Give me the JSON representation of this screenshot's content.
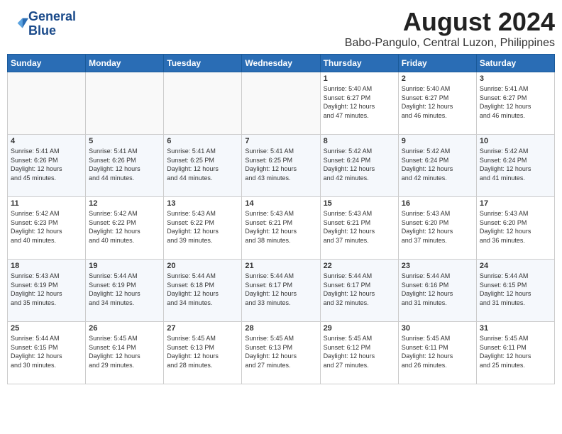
{
  "header": {
    "logo_line1": "General",
    "logo_line2": "Blue",
    "month_year": "August 2024",
    "location": "Babo-Pangulo, Central Luzon, Philippines"
  },
  "weekdays": [
    "Sunday",
    "Monday",
    "Tuesday",
    "Wednesday",
    "Thursday",
    "Friday",
    "Saturday"
  ],
  "weeks": [
    [
      {
        "day": "",
        "info": ""
      },
      {
        "day": "",
        "info": ""
      },
      {
        "day": "",
        "info": ""
      },
      {
        "day": "",
        "info": ""
      },
      {
        "day": "1",
        "info": "Sunrise: 5:40 AM\nSunset: 6:27 PM\nDaylight: 12 hours\nand 47 minutes."
      },
      {
        "day": "2",
        "info": "Sunrise: 5:40 AM\nSunset: 6:27 PM\nDaylight: 12 hours\nand 46 minutes."
      },
      {
        "day": "3",
        "info": "Sunrise: 5:41 AM\nSunset: 6:27 PM\nDaylight: 12 hours\nand 46 minutes."
      }
    ],
    [
      {
        "day": "4",
        "info": "Sunrise: 5:41 AM\nSunset: 6:26 PM\nDaylight: 12 hours\nand 45 minutes."
      },
      {
        "day": "5",
        "info": "Sunrise: 5:41 AM\nSunset: 6:26 PM\nDaylight: 12 hours\nand 44 minutes."
      },
      {
        "day": "6",
        "info": "Sunrise: 5:41 AM\nSunset: 6:25 PM\nDaylight: 12 hours\nand 44 minutes."
      },
      {
        "day": "7",
        "info": "Sunrise: 5:41 AM\nSunset: 6:25 PM\nDaylight: 12 hours\nand 43 minutes."
      },
      {
        "day": "8",
        "info": "Sunrise: 5:42 AM\nSunset: 6:24 PM\nDaylight: 12 hours\nand 42 minutes."
      },
      {
        "day": "9",
        "info": "Sunrise: 5:42 AM\nSunset: 6:24 PM\nDaylight: 12 hours\nand 42 minutes."
      },
      {
        "day": "10",
        "info": "Sunrise: 5:42 AM\nSunset: 6:24 PM\nDaylight: 12 hours\nand 41 minutes."
      }
    ],
    [
      {
        "day": "11",
        "info": "Sunrise: 5:42 AM\nSunset: 6:23 PM\nDaylight: 12 hours\nand 40 minutes."
      },
      {
        "day": "12",
        "info": "Sunrise: 5:42 AM\nSunset: 6:22 PM\nDaylight: 12 hours\nand 40 minutes."
      },
      {
        "day": "13",
        "info": "Sunrise: 5:43 AM\nSunset: 6:22 PM\nDaylight: 12 hours\nand 39 minutes."
      },
      {
        "day": "14",
        "info": "Sunrise: 5:43 AM\nSunset: 6:21 PM\nDaylight: 12 hours\nand 38 minutes."
      },
      {
        "day": "15",
        "info": "Sunrise: 5:43 AM\nSunset: 6:21 PM\nDaylight: 12 hours\nand 37 minutes."
      },
      {
        "day": "16",
        "info": "Sunrise: 5:43 AM\nSunset: 6:20 PM\nDaylight: 12 hours\nand 37 minutes."
      },
      {
        "day": "17",
        "info": "Sunrise: 5:43 AM\nSunset: 6:20 PM\nDaylight: 12 hours\nand 36 minutes."
      }
    ],
    [
      {
        "day": "18",
        "info": "Sunrise: 5:43 AM\nSunset: 6:19 PM\nDaylight: 12 hours\nand 35 minutes."
      },
      {
        "day": "19",
        "info": "Sunrise: 5:44 AM\nSunset: 6:19 PM\nDaylight: 12 hours\nand 34 minutes."
      },
      {
        "day": "20",
        "info": "Sunrise: 5:44 AM\nSunset: 6:18 PM\nDaylight: 12 hours\nand 34 minutes."
      },
      {
        "day": "21",
        "info": "Sunrise: 5:44 AM\nSunset: 6:17 PM\nDaylight: 12 hours\nand 33 minutes."
      },
      {
        "day": "22",
        "info": "Sunrise: 5:44 AM\nSunset: 6:17 PM\nDaylight: 12 hours\nand 32 minutes."
      },
      {
        "day": "23",
        "info": "Sunrise: 5:44 AM\nSunset: 6:16 PM\nDaylight: 12 hours\nand 31 minutes."
      },
      {
        "day": "24",
        "info": "Sunrise: 5:44 AM\nSunset: 6:15 PM\nDaylight: 12 hours\nand 31 minutes."
      }
    ],
    [
      {
        "day": "25",
        "info": "Sunrise: 5:44 AM\nSunset: 6:15 PM\nDaylight: 12 hours\nand 30 minutes."
      },
      {
        "day": "26",
        "info": "Sunrise: 5:45 AM\nSunset: 6:14 PM\nDaylight: 12 hours\nand 29 minutes."
      },
      {
        "day": "27",
        "info": "Sunrise: 5:45 AM\nSunset: 6:13 PM\nDaylight: 12 hours\nand 28 minutes."
      },
      {
        "day": "28",
        "info": "Sunrise: 5:45 AM\nSunset: 6:13 PM\nDaylight: 12 hours\nand 27 minutes."
      },
      {
        "day": "29",
        "info": "Sunrise: 5:45 AM\nSunset: 6:12 PM\nDaylight: 12 hours\nand 27 minutes."
      },
      {
        "day": "30",
        "info": "Sunrise: 5:45 AM\nSunset: 6:11 PM\nDaylight: 12 hours\nand 26 minutes."
      },
      {
        "day": "31",
        "info": "Sunrise: 5:45 AM\nSunset: 6:11 PM\nDaylight: 12 hours\nand 25 minutes."
      }
    ]
  ]
}
